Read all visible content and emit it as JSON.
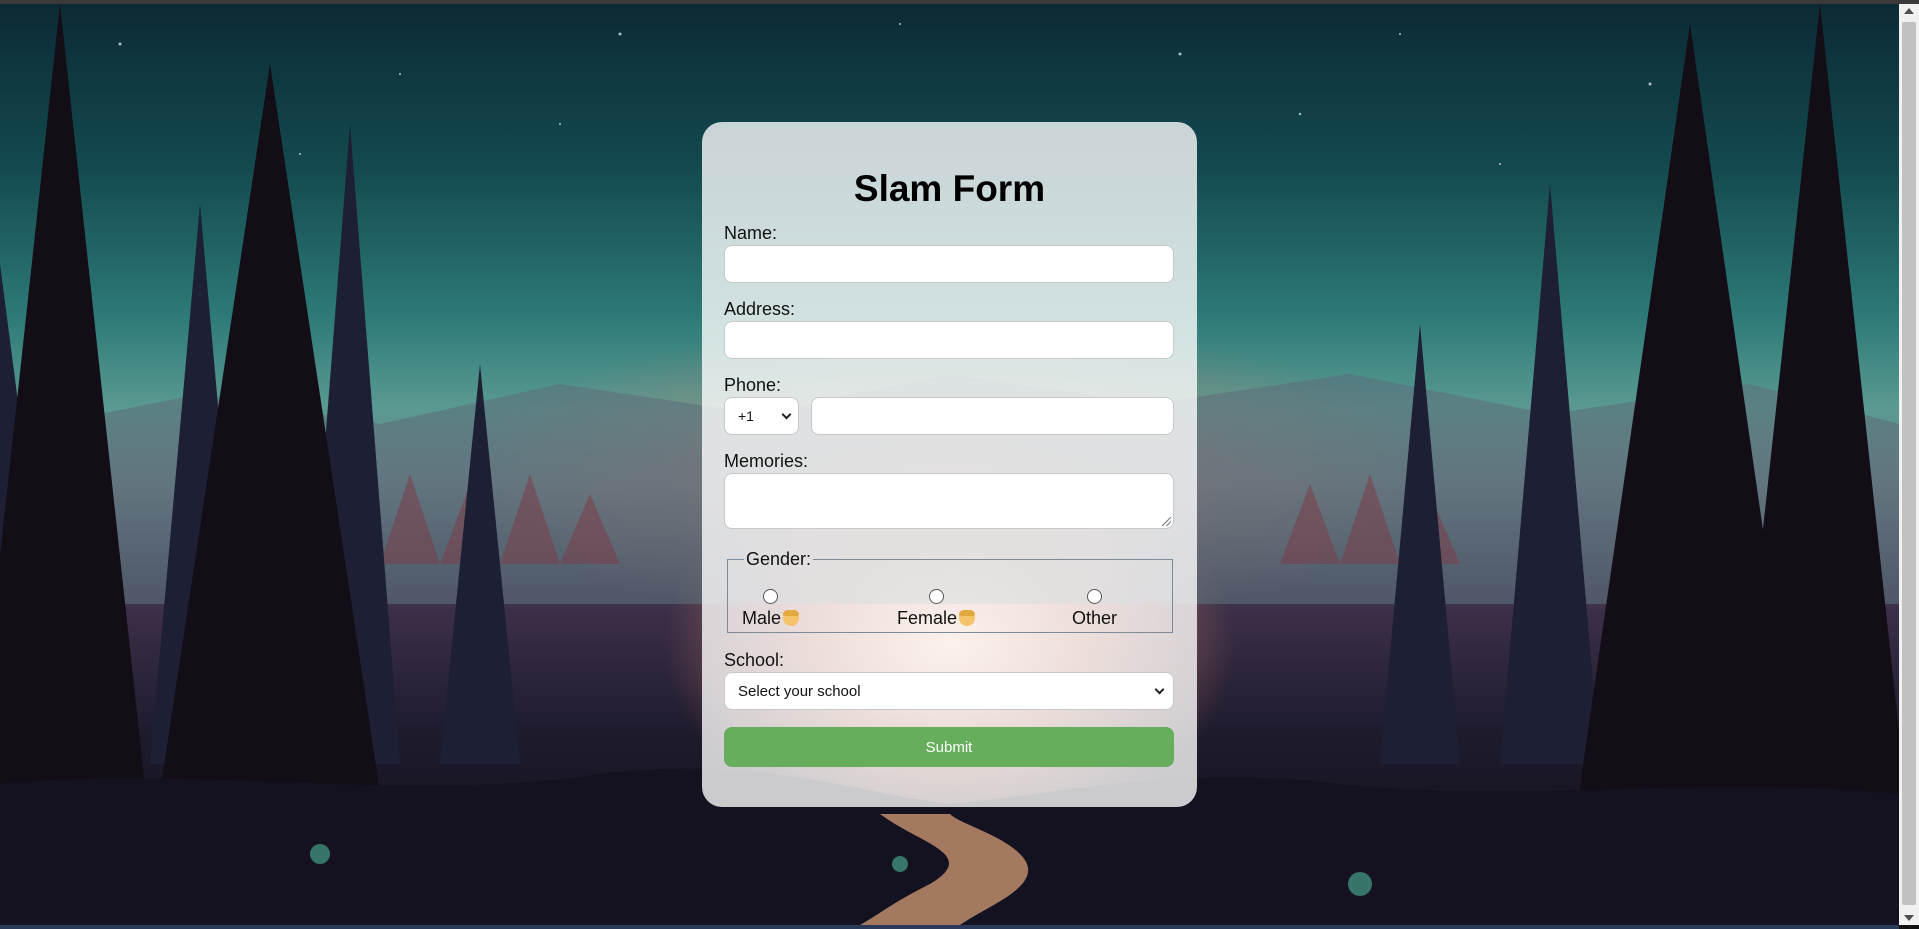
{
  "form": {
    "title": "Slam Form",
    "name_label": "Name:",
    "address_label": "Address:",
    "phone_label": "Phone:",
    "country_code": "+1",
    "memories_label": "Memories:",
    "gender_legend": "Gender:",
    "gender_options": [
      {
        "label": "Male",
        "emoji": "boy-emoji"
      },
      {
        "label": "Female",
        "emoji": "girl-emoji"
      },
      {
        "label": "Other"
      }
    ],
    "school_label": "School:",
    "school_placeholder": "Select your school",
    "submit_label": "Submit"
  },
  "colors": {
    "submit": "#66ad5c",
    "card": "rgba(255,255,255,0.78)"
  }
}
